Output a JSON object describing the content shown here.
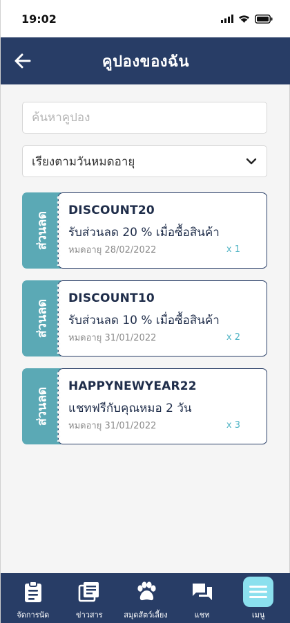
{
  "status_bar": {
    "time": "19:02"
  },
  "header": {
    "title": "คูปองของฉัน"
  },
  "search": {
    "placeholder": "ค้นหาคูปอง",
    "value": ""
  },
  "sort": {
    "selected": "เรียงตามวันหมดอายุ"
  },
  "coupons": [
    {
      "tab_label": "ส่วนลด",
      "code": "DISCOUNT20",
      "description": "รับส่วนลด 20 % เมื่อซื้อสินค้า",
      "expiry": "หมดอายุ 28/02/2022",
      "quantity": "x 1"
    },
    {
      "tab_label": "ส่วนลด",
      "code": "DISCOUNT10",
      "description": "รับส่วนลด 10 % เมื่อซื้อสินค้า",
      "expiry": "หมดอายุ 31/01/2022",
      "quantity": "x 2"
    },
    {
      "tab_label": "ส่วนลด",
      "code": "HAPPYNEWYEAR22",
      "description": "แชทฟรีกับคุณหมอ 2 วัน",
      "expiry": "หมดอายุ 31/01/2022",
      "quantity": "x 3"
    }
  ],
  "bottom_nav": {
    "items": [
      {
        "label": "จัดการนัด",
        "icon": "clipboard-icon"
      },
      {
        "label": "ข่าวสาร",
        "icon": "news-icon"
      },
      {
        "label": "สมุดสัตว์เลี้ยง",
        "icon": "paw-icon"
      },
      {
        "label": "แชท",
        "icon": "chat-icon"
      },
      {
        "label": "เมนู",
        "icon": "menu-icon",
        "active": true
      }
    ]
  },
  "colors": {
    "header": "#283d66",
    "coupon_tab": "#5ba9b5",
    "quantity": "#4fb3c4",
    "active_nav": "#8be0ee"
  }
}
